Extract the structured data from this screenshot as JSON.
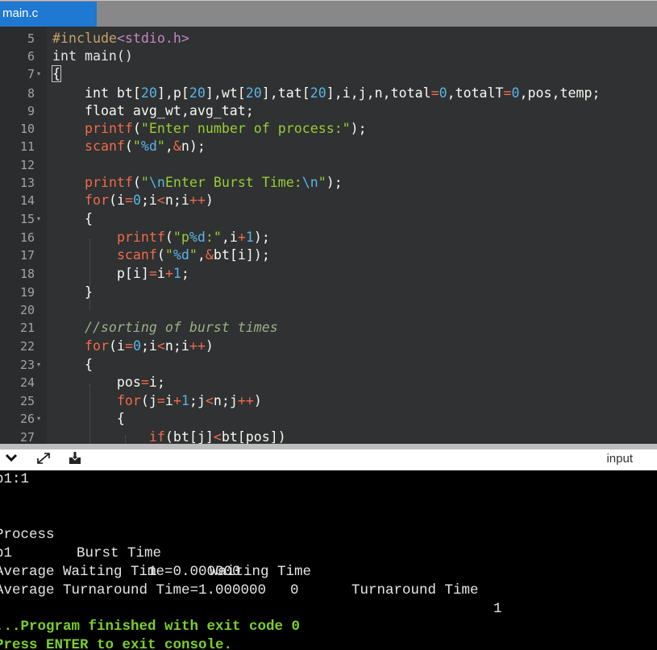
{
  "tab": {
    "title": "main.c"
  },
  "editor": {
    "lines": [
      {
        "n": "5",
        "fold": false
      },
      {
        "n": "6",
        "fold": false
      },
      {
        "n": "7",
        "fold": true
      },
      {
        "n": "8",
        "fold": false
      },
      {
        "n": "9",
        "fold": false
      },
      {
        "n": "10",
        "fold": false
      },
      {
        "n": "11",
        "fold": false
      },
      {
        "n": "12",
        "fold": false
      },
      {
        "n": "13",
        "fold": false
      },
      {
        "n": "14",
        "fold": false
      },
      {
        "n": "15",
        "fold": true
      },
      {
        "n": "16",
        "fold": false
      },
      {
        "n": "17",
        "fold": false
      },
      {
        "n": "18",
        "fold": false
      },
      {
        "n": "19",
        "fold": false
      },
      {
        "n": "20",
        "fold": false
      },
      {
        "n": "21",
        "fold": false
      },
      {
        "n": "22",
        "fold": false
      },
      {
        "n": "23",
        "fold": true
      },
      {
        "n": "24",
        "fold": false
      },
      {
        "n": "25",
        "fold": false
      },
      {
        "n": "26",
        "fold": true
      },
      {
        "n": "27",
        "fold": false
      }
    ],
    "code": {
      "l5_a": "#include",
      "l5_b": "<stdio.h>",
      "l6": "int main()",
      "l7": "{",
      "l8_a": "    int bt[",
      "l8_b": "20",
      "l8_c": "],p[",
      "l8_d": "20",
      "l8_e": "],wt[",
      "l8_f": "20",
      "l8_g": "],tat[",
      "l8_h": "20",
      "l8_i": "],i,j,n,total",
      "l8_j": "=",
      "l8_k": "0",
      "l8_l": ",totalT",
      "l8_m": "=",
      "l8_n": "0",
      "l8_o": ",pos,temp;",
      "l9": "    float avg_wt,avg_tat;",
      "l10_a": "    ",
      "l10_b": "printf",
      "l10_c": "(",
      "l10_d": "\"Enter number of process:\"",
      "l10_e": ");",
      "l11_a": "    ",
      "l11_b": "scanf",
      "l11_c": "(",
      "l11_d": "\"",
      "l11_e": "%d",
      "l11_f": "\"",
      "l11_g": ",",
      "l11_h": "&",
      "l11_i": "n);",
      "l13_a": "    ",
      "l13_b": "printf",
      "l13_c": "(",
      "l13_d": "\"",
      "l13_e": "\\n",
      "l13_f": "Enter Burst Time:",
      "l13_g": "\\n",
      "l13_h": "\"",
      "l13_i": ");",
      "l14_a": "    ",
      "l14_b": "for",
      "l14_c": "(i",
      "l14_d": "=",
      "l14_e": "0",
      "l14_f": ";i",
      "l14_g": "<",
      "l14_h": "n;i",
      "l14_i": "++",
      "l14_j": ")",
      "l15": "    {",
      "l16_a": "        ",
      "l16_b": "printf",
      "l16_c": "(",
      "l16_d": "\"p",
      "l16_e": "%d",
      "l16_f": ":\"",
      "l16_g": ",i",
      "l16_h": "+",
      "l16_i": "1",
      "l16_j": ");",
      "l17_a": "        ",
      "l17_b": "scanf",
      "l17_c": "(",
      "l17_d": "\"",
      "l17_e": "%d",
      "l17_f": "\"",
      "l17_g": ",",
      "l17_h": "&",
      "l17_i": "bt[i]);",
      "l18_a": "        p[i]",
      "l18_b": "=",
      "l18_c": "i",
      "l18_d": "+",
      "l18_e": "1",
      "l18_f": ";",
      "l19": "    }",
      "l21": "    //sorting of burst times",
      "l22_a": "    ",
      "l22_b": "for",
      "l22_c": "(i",
      "l22_d": "=",
      "l22_e": "0",
      "l22_f": ";i",
      "l22_g": "<",
      "l22_h": "n;i",
      "l22_i": "++",
      "l22_j": ")",
      "l23": "    {",
      "l24_a": "        pos",
      "l24_b": "=",
      "l24_c": "i;",
      "l25_a": "        ",
      "l25_b": "for",
      "l25_c": "(j",
      "l25_d": "=",
      "l25_e": "i",
      "l25_f": "+",
      "l25_g": "1",
      "l25_h": ";j",
      "l25_i": "<",
      "l25_j": "n;j",
      "l25_k": "++",
      "l25_l": ")",
      "l26": "        {",
      "l27_a": "            ",
      "l27_b": "if",
      "l27_c": "(bt[j]",
      "l27_d": "<",
      "l27_e": "bt[pos])"
    }
  },
  "console_toolbar": {
    "collapse_icon": "chevron-down-icon",
    "expand_icon": "expand-arrows-icon",
    "download_icon": "download-icon",
    "input_label": "input"
  },
  "console": {
    "prompt_line": "p1:1",
    "headers": [
      "Process",
      "Burst Time",
      "Waiting Time",
      "Turnaround Time"
    ],
    "row": [
      "p1",
      "1",
      "0",
      "1"
    ],
    "avg_wait": "Average Waiting Time=0.000000",
    "avg_tat": "Average Turnaround Time=1.000000",
    "finished": "...Program finished with exit code 0",
    "press_enter": "Press ENTER to exit console."
  }
}
